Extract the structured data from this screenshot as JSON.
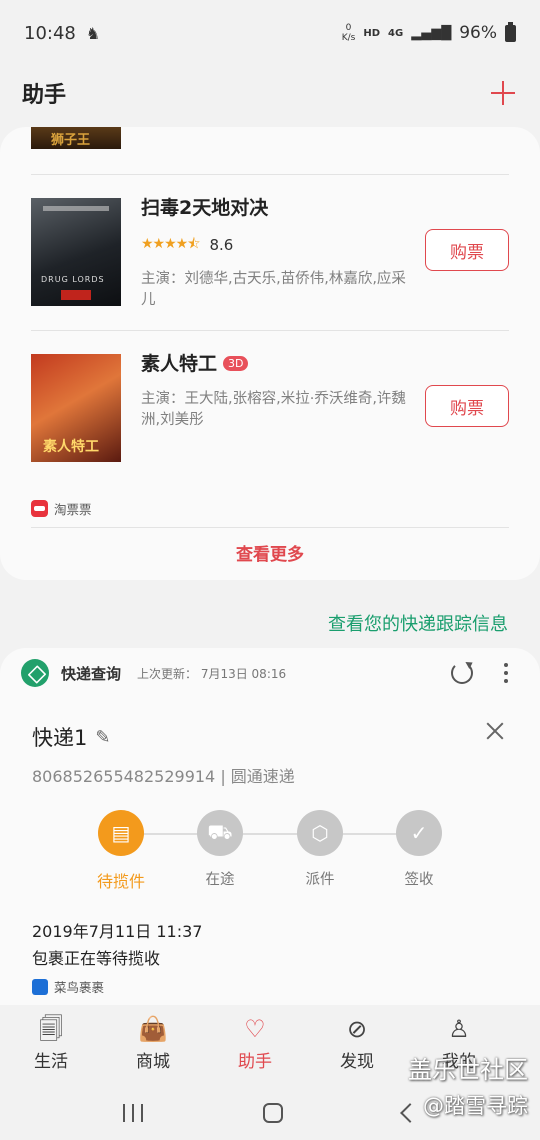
{
  "status_bar": {
    "time": "10:48",
    "net_speed_top": "0",
    "net_speed_unit": "K/s",
    "hd": "HD",
    "network": "4G",
    "battery": "96%"
  },
  "header": {
    "title": "助手"
  },
  "movies": {
    "partial_poster_text": "狮子王",
    "items": [
      {
        "title": "扫毒2天地对决",
        "rating": "8.6",
        "stars": 4.5,
        "cast": "主演：刘德华,古天乐,苗侨伟,林嘉欣,应采儿",
        "buy_label": "购票",
        "poster_text": "DRUG LORDS"
      },
      {
        "title": "素人特工",
        "badge": "3D",
        "cast": "主演：王大陆,张榕容,米拉·乔沃维奇,许魏洲,刘美彤",
        "buy_label": "购票",
        "poster_text": "素人特工"
      }
    ],
    "provider": "淘票票",
    "see_more": "查看更多"
  },
  "tracking_link": "查看您的快递跟踪信息",
  "express": {
    "title": "快递查询",
    "last_updated": "上次更新： 7月13日 08:16",
    "package_name": "快递1",
    "tracking_number": "806852655482529914 | 圆通速递",
    "steps": [
      {
        "label": "待揽件",
        "active": true
      },
      {
        "label": "在途",
        "active": false
      },
      {
        "label": "派件",
        "active": false
      },
      {
        "label": "签收",
        "active": false
      }
    ],
    "event_time": "2019年7月11日 11:37",
    "event_desc": "包裹正在等待揽收",
    "provider": "菜鸟裹裹",
    "accent_color": "#f39a1c"
  },
  "bottom_nav": [
    {
      "label": "生活",
      "icon": "bookmark-icon"
    },
    {
      "label": "商城",
      "icon": "shopping-bag-icon"
    },
    {
      "label": "助手",
      "icon": "heart-icon",
      "active": true
    },
    {
      "label": "发现",
      "icon": "compass-icon"
    },
    {
      "label": "我的",
      "icon": "person-icon"
    }
  ],
  "watermark": {
    "line1": "盖乐世社区",
    "line2": "@踏雪寻踪"
  },
  "colors": {
    "brand_red": "#e0484e",
    "green": "#1a9e6e",
    "orange": "#f39a1c"
  }
}
